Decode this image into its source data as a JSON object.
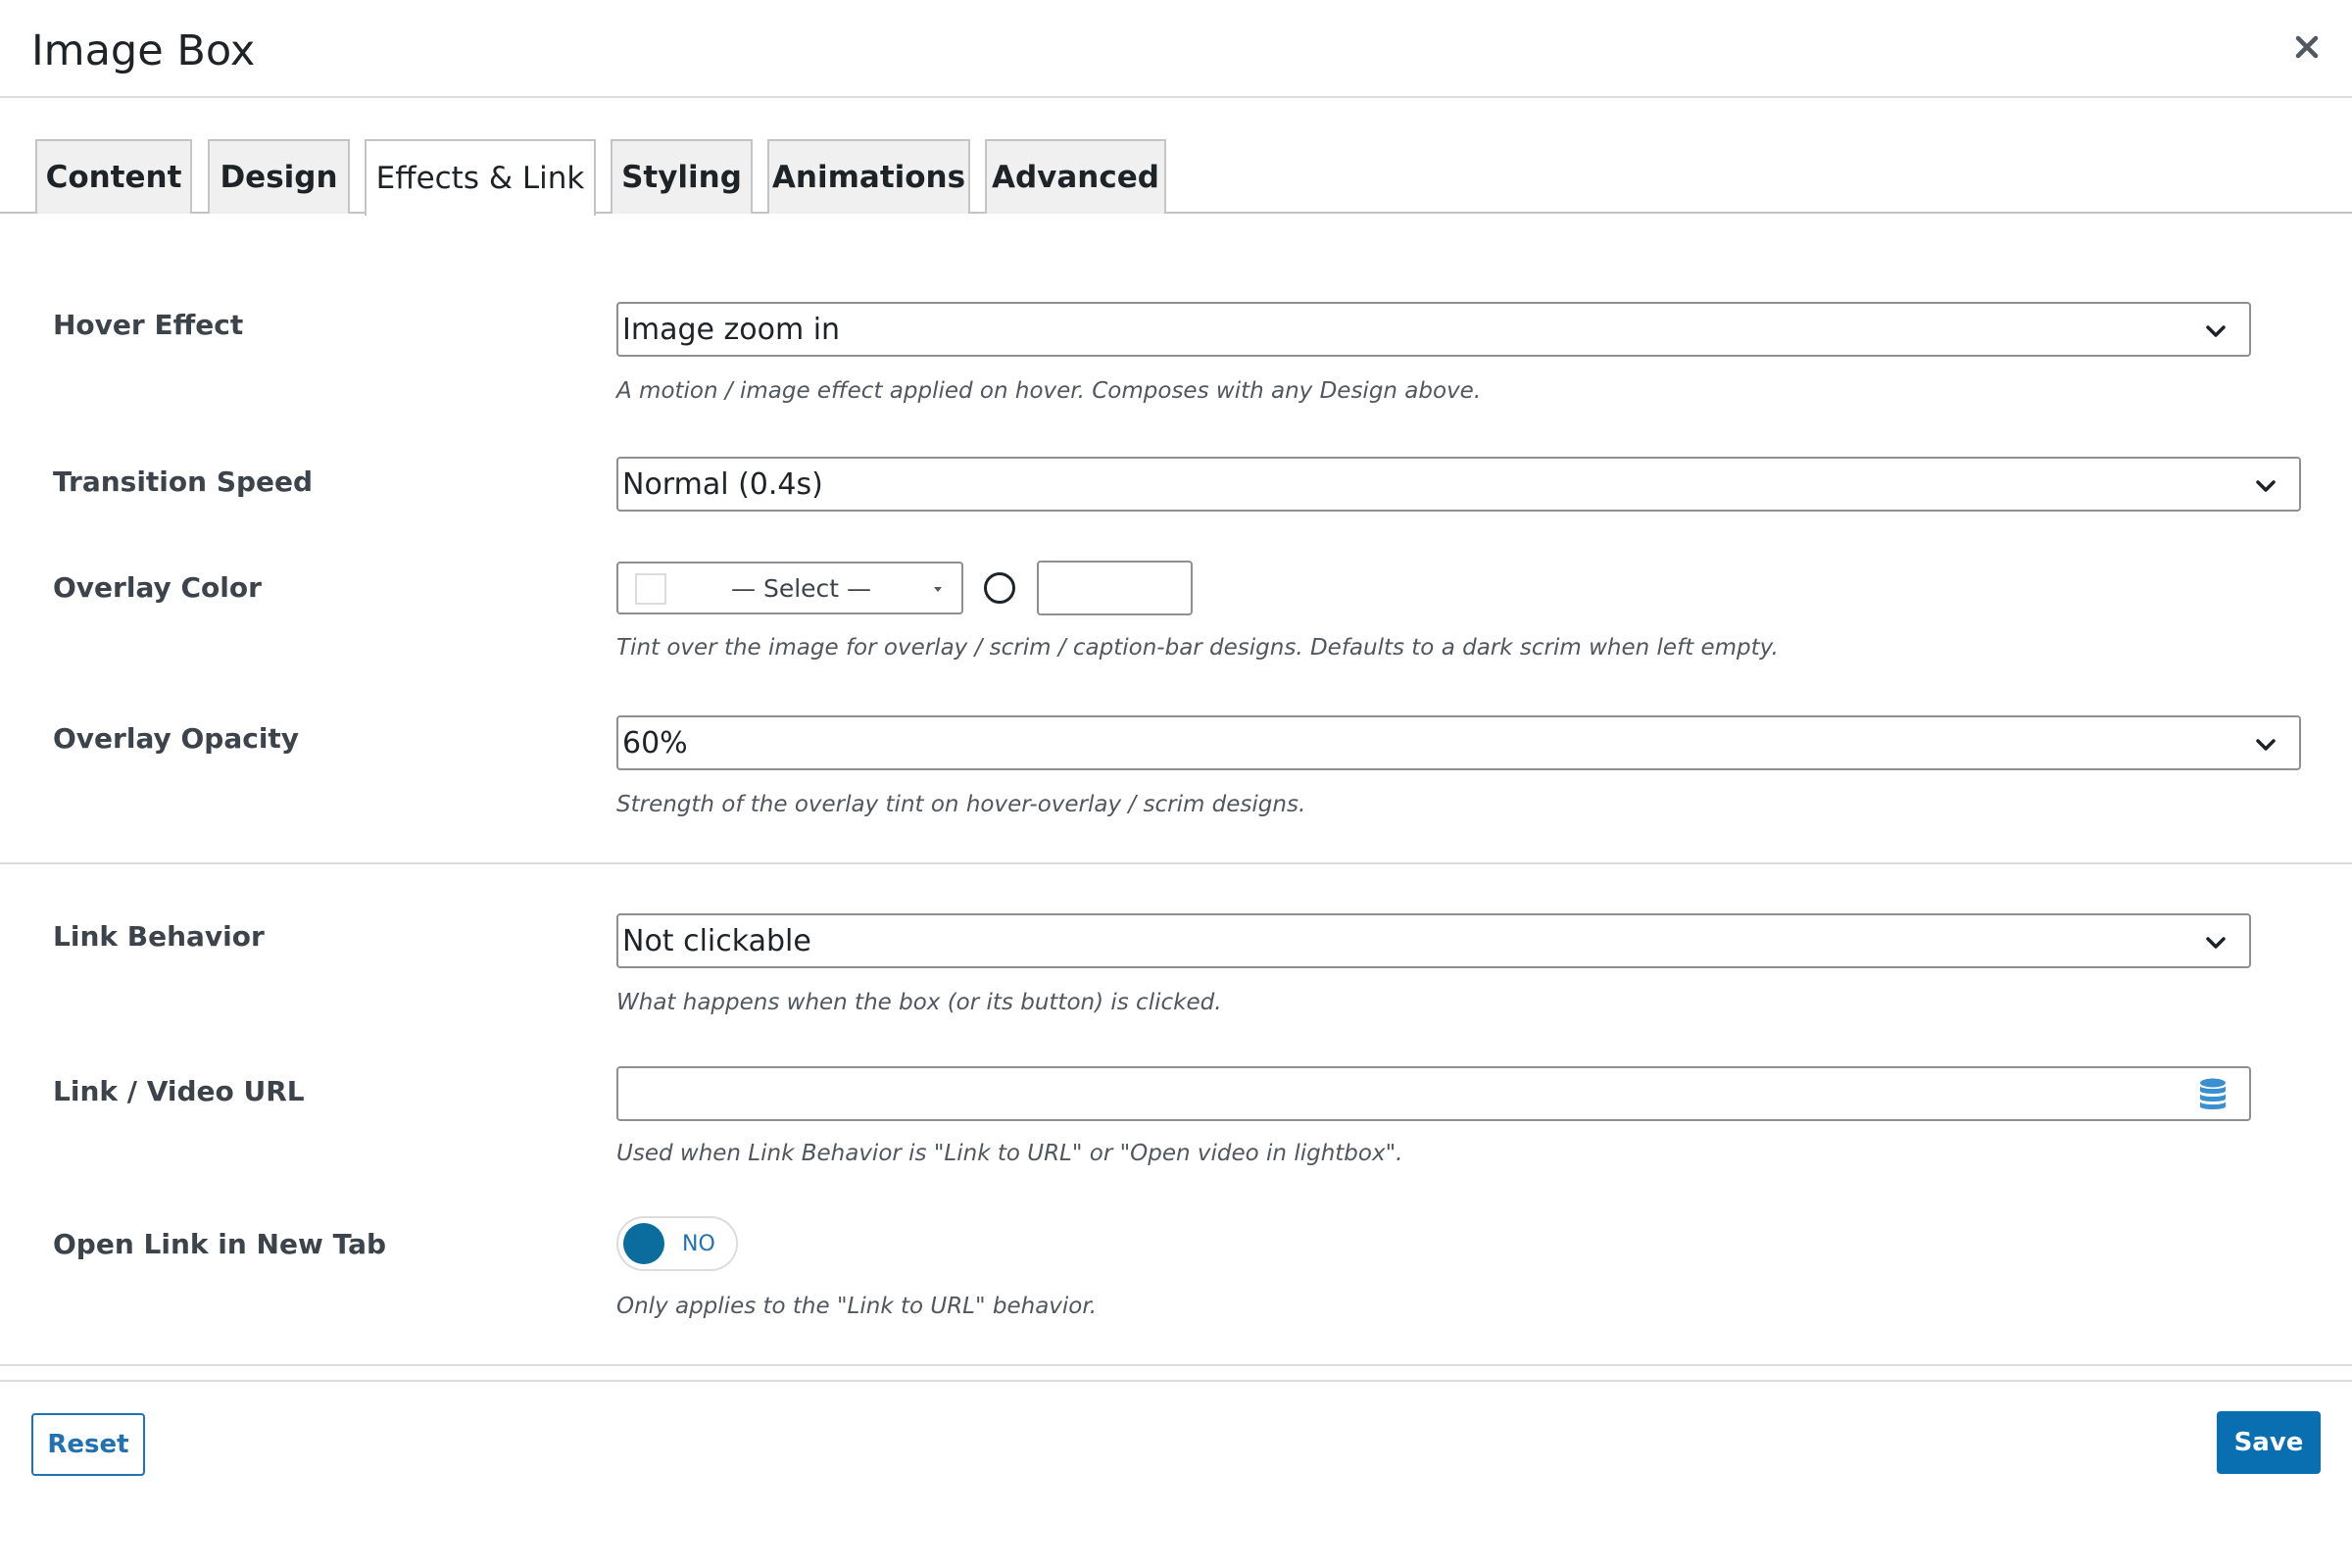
{
  "dialog": {
    "title": "Image Box",
    "close_icon": "close-icon"
  },
  "tabs": [
    {
      "label": "Content",
      "active": false
    },
    {
      "label": "Design",
      "active": false
    },
    {
      "label": "Effects & Link",
      "active": true
    },
    {
      "label": "Styling",
      "active": false
    },
    {
      "label": "Animations",
      "active": false
    },
    {
      "label": "Advanced",
      "active": false
    }
  ],
  "fields": {
    "hover_effect": {
      "label": "Hover Effect",
      "value": "Image zoom in",
      "help": "A motion / image effect applied on hover. Composes with any Design above."
    },
    "transition_speed": {
      "label": "Transition Speed",
      "value": "Normal (0.4s)"
    },
    "overlay_color": {
      "label": "Overlay Color",
      "select_label": "— Select —",
      "hex_value": "",
      "help": "Tint over the image for overlay / scrim / caption-bar designs. Defaults to a dark scrim when left empty."
    },
    "overlay_opacity": {
      "label": "Overlay Opacity",
      "value": "60%",
      "help": "Strength of the overlay tint on hover-overlay / scrim designs."
    },
    "link_behavior": {
      "label": "Link Behavior",
      "value": "Not clickable",
      "help": "What happens when the box (or its button) is clicked."
    },
    "link_url": {
      "label": "Link / Video URL",
      "value": "",
      "icon": "database-icon",
      "help": "Used when Link Behavior is \"Link to URL\" or \"Open video in lightbox\"."
    },
    "open_new_tab": {
      "label": "Open Link in New Tab",
      "toggle_text": "NO",
      "on": false,
      "help": "Only applies to the \"Link to URL\" behavior."
    }
  },
  "footer": {
    "reset_label": "Reset",
    "save_label": "Save"
  },
  "colors": {
    "accent": "#2271b1",
    "save_bg": "#0a6fb1",
    "toggle_knob": "#0a6d9e",
    "border": "#8c8f94"
  }
}
